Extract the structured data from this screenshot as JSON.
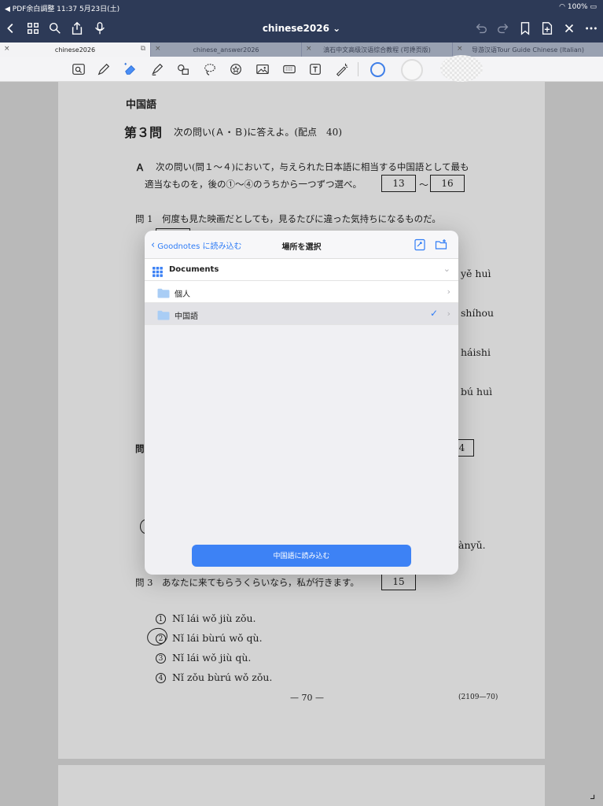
{
  "status": {
    "left": "◀ PDF余白調整   11:37   5月23日(土)",
    "right": "100%"
  },
  "document_title": "chinese2026 ⌄",
  "tabs": [
    {
      "label": "chinese2026",
      "active": true
    },
    {
      "label": "chinese_answer2026",
      "active": false
    },
    {
      "label": "滇石中文高级汉语综合教程 (可搀页版)",
      "active": false
    },
    {
      "label": "导游汉语Tour Guide Chinese (Italian)",
      "active": false
    }
  ],
  "page": {
    "subject": "中国語",
    "question_heading": "第３問",
    "question_intro": "次の問い(Ａ・Ｂ)に答えよ。(配点　40)",
    "section_a_label": "Ａ",
    "section_a_text_1": "次の問い(問１～４)において，与えられた日本語に相当する中国語として最も",
    "section_a_text_2": "適当なものを，後の①～④のうちから一つずつ選べ。",
    "answer_box_from": "13",
    "range_sep": "～",
    "answer_box_to": "16",
    "q1_text": "問 1　何度も見た映画だとしても，見るたびに違った気持ちになるものだ。",
    "right_fragments": [
      "yě huì",
      "shíhou",
      "háishi",
      "bú huì"
    ],
    "q2_label": "問",
    "q2_box": "4",
    "q2_fragment": "ànyǔ.",
    "q3_text": "問 3　あなたに来てもらうくらいなら，私が行きます。",
    "q3_box": "15",
    "options": [
      {
        "num": "1",
        "text": "Nǐ lái wǒ jiù zǒu."
      },
      {
        "num": "2",
        "text": "Nǐ lái bùrú wǒ qù."
      },
      {
        "num": "3",
        "text": "Nǐ lái wǒ jiù qù."
      },
      {
        "num": "4",
        "text": "Nǐ zǒu bùrú wǒ zǒu."
      }
    ],
    "page_number": "— 70 —",
    "page_code": "(2109—70)"
  },
  "dialog": {
    "back_label": "Goodnotes に読み込む",
    "title": "場所を選択",
    "root_label": "Documents",
    "folders": [
      {
        "name": "個人",
        "selected": false
      },
      {
        "name": "中国語",
        "selected": true
      }
    ],
    "import_button": "中国語に読み込む"
  },
  "colors": {
    "topbar": "#2d3a57",
    "accent": "#3d82f5",
    "folder": "#a9cdf5"
  }
}
